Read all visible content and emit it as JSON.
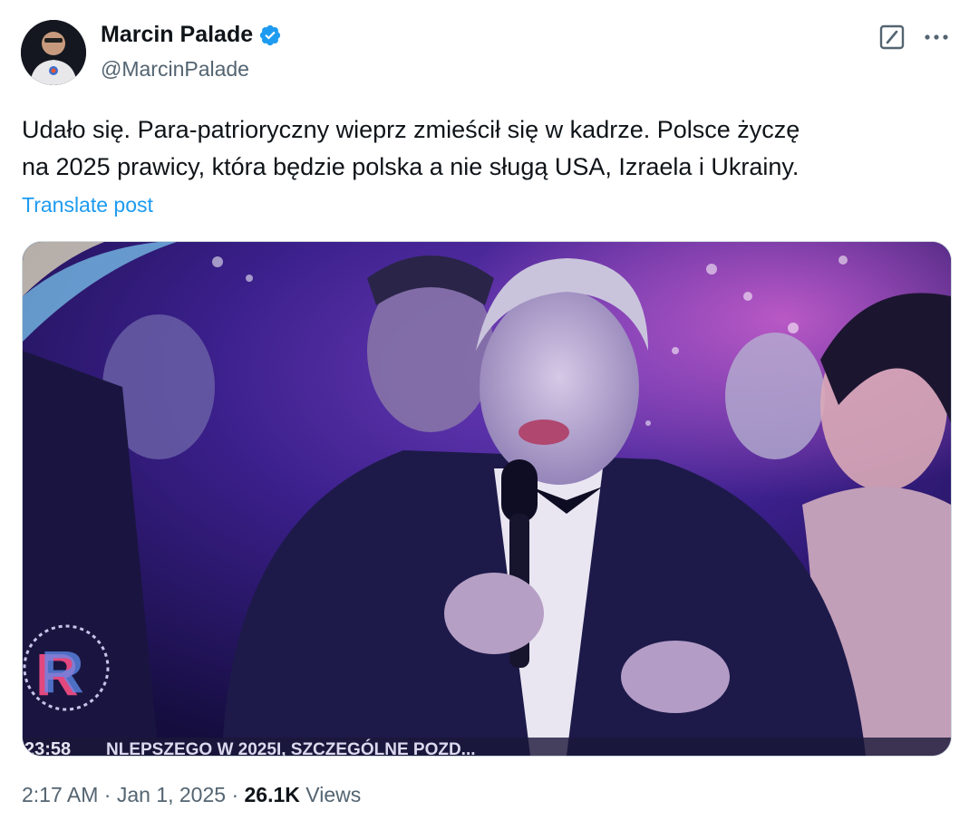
{
  "author": {
    "name": "Marcin Palade",
    "handle": "@MarcinPalade",
    "verified": true
  },
  "post": {
    "text_line1": "Udało się. Para-patrioryczny wieprz zmieścił się w kadrze. Polsce życzę",
    "text_line2": "na 2025 prawicy, która będzie polska a nie sługą USA, Izraela i Ukrainy.",
    "translate_label": "Translate post"
  },
  "media": {
    "time_overlay": "23:58",
    "ticker_text": "NLEPSZEGO W 2025I, SZCZEGÓLNE POZD..."
  },
  "meta": {
    "time": "2:17 AM",
    "separator": "·",
    "date": "Jan 1, 2025",
    "views_count": "26.1K",
    "views_label": "Views"
  },
  "icons": {
    "verified": "verified-badge-icon",
    "grok": "grok-icon",
    "more": "more-icon"
  },
  "colors": {
    "accent": "#1d9bf0",
    "secondary_text": "#536471",
    "primary_text": "#0f1419"
  }
}
